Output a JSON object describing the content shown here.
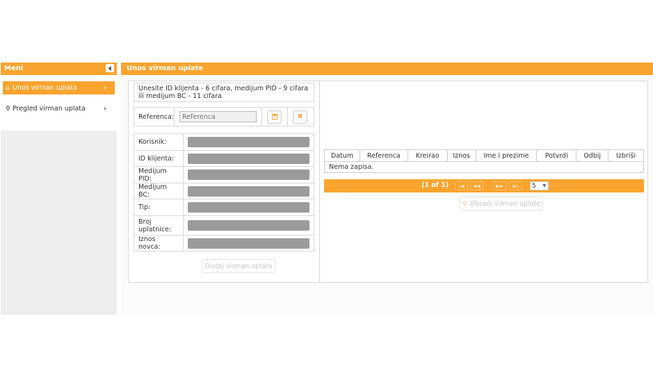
{
  "sidebar": {
    "title": "Meni",
    "items": [
      {
        "label": "Unos virman uplata",
        "icon": "home-icon",
        "active": true
      },
      {
        "label": "Pregled virman uplata",
        "icon": "search-icon",
        "active": false
      }
    ]
  },
  "main": {
    "title": "Unos virman uplate",
    "info_text": "Unesite ID klijenta - 6 cifara, medijum PID - 9 cifara ili medijum BC - 11 cifara",
    "reference": {
      "label": "Referenca:",
      "placeholder": "Referenca"
    },
    "fields": [
      {
        "label": "Korisnik:"
      },
      {
        "label": "ID klijenta:"
      },
      {
        "label": "Medijum PID:"
      },
      {
        "label": "Medijum BC:"
      },
      {
        "label": "Tip:"
      },
      {
        "label": "Broj uplatnice:"
      },
      {
        "label": "Iznos novca:"
      }
    ],
    "add_button": "Dodaj virman uplatu",
    "table": {
      "columns": [
        "Datum",
        "Referenca",
        "Kreirao",
        "Iznos",
        "Ime i prezime",
        "Potvrdi",
        "Odbij",
        "Izbriši"
      ],
      "empty_message": "Nema zapisa."
    },
    "pager": {
      "text": "(1 of 1)",
      "page_size": "5"
    },
    "process_button": "Obradi virman uplate"
  },
  "colors": {
    "accent": "#f9a42f",
    "field_gray": "#9b9b9b"
  }
}
